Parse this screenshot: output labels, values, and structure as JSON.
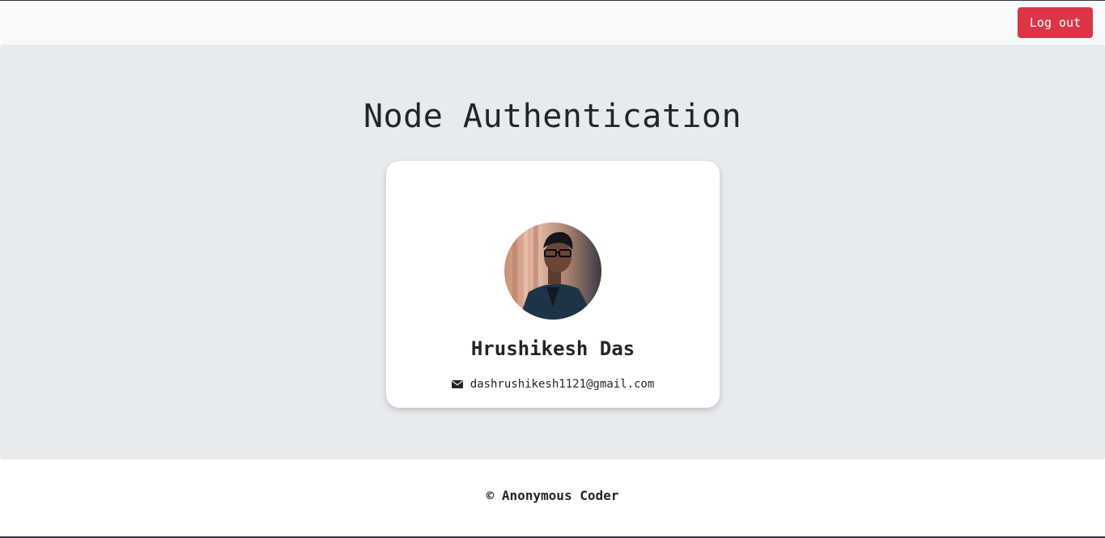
{
  "navbar": {
    "logout_label": "Log out",
    "logout_color": "#dc3545"
  },
  "main": {
    "title": "Node Authentication"
  },
  "profile": {
    "name": "Hrushikesh Das",
    "email": "dashrushikesh1121@gmail.com",
    "email_icon": "envelope-icon"
  },
  "footer": {
    "text": "© Anonymous Coder"
  }
}
